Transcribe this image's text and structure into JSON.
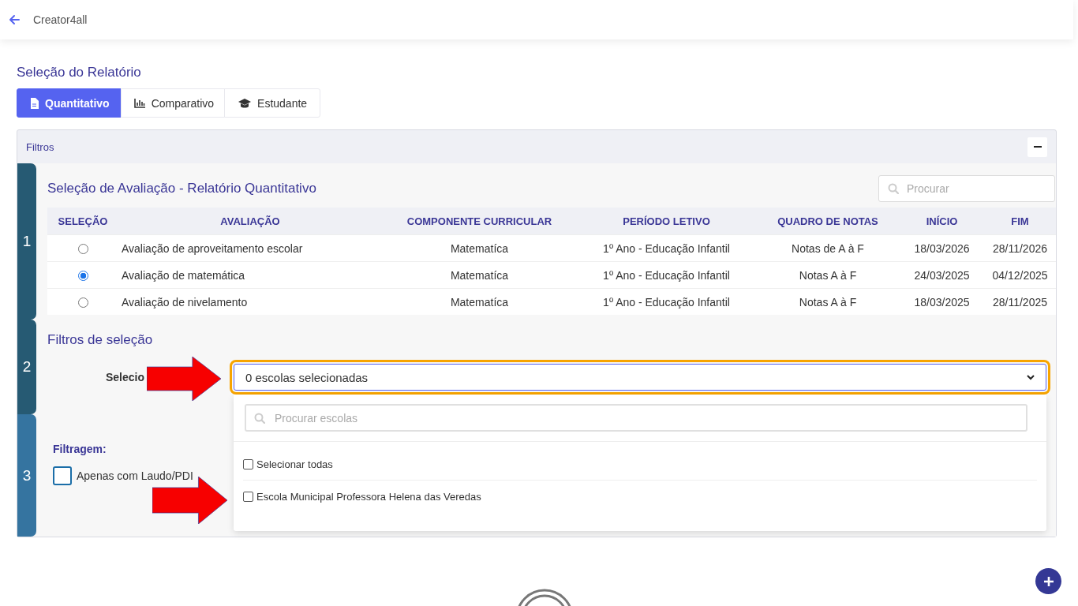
{
  "header": {
    "title": "Creator4all"
  },
  "page_title": "Seleção do Relatório",
  "tabs": [
    {
      "label": "Quantitativo",
      "kind": "document",
      "selected": true
    },
    {
      "label": "Comparativo",
      "kind": "chart",
      "selected": false
    },
    {
      "label": "Estudante",
      "kind": "cap",
      "selected": false
    }
  ],
  "filters_panel": {
    "title": "Filtros",
    "expanded": true
  },
  "steps": [
    {
      "number": "1",
      "color": "#265a73"
    },
    {
      "number": "2",
      "color": "#265a73"
    },
    {
      "number": "3",
      "color": "#3574a0"
    }
  ],
  "evaluation_section": {
    "title": "Seleção de Avaliação - Relatório Quantitativo",
    "search": {
      "placeholder": "Procurar"
    },
    "table": {
      "columns": [
        "SELEÇÃO",
        "AVALIAÇÃO",
        "COMPONENTE CURRICULAR",
        "PERÍODO LETIVO",
        "QUADRO DE NOTAS",
        "INÍCIO",
        "FIM"
      ],
      "rows": [
        {
          "selected": false,
          "cells": [
            "",
            "Avaliação de aproveitamento escolar",
            "Matematíca",
            "1º Ano - Educação Infantil",
            "Notas de A à F",
            "18/03/2026",
            "28/11/2026"
          ]
        },
        {
          "selected": true,
          "cells": [
            "",
            "Avaliação de matemática",
            "Matematíca",
            "1º Ano - Educação Infantil",
            "Notas A à F",
            "24/03/2025",
            "04/12/2025"
          ]
        },
        {
          "selected": false,
          "cells": [
            "",
            "Avaliação de nivelamento",
            "Matematíca",
            "1º Ano - Educação Infantil",
            "Notas A à F",
            "18/03/2025",
            "28/11/2025"
          ]
        }
      ]
    }
  },
  "selection_filters": {
    "title": "Filtros de seleção",
    "school_field": {
      "label": "Selecio",
      "value": "0 escolas selecionadas",
      "focused": true
    },
    "dropdown": {
      "search": {
        "placeholder": "Procurar escolas"
      },
      "options": [
        {
          "label": "Selecionar todas",
          "checked": false
        },
        {
          "label": "Escola Municipal Professora Helena das Veredas",
          "checked": false
        }
      ]
    }
  },
  "filtering": {
    "title": "Filtragem:",
    "options": [
      {
        "label": "Apenas com Laudo/PDI",
        "checked": false
      }
    ]
  },
  "annotations": [
    {
      "kind": "arrow"
    },
    {
      "kind": "arrow"
    }
  ]
}
